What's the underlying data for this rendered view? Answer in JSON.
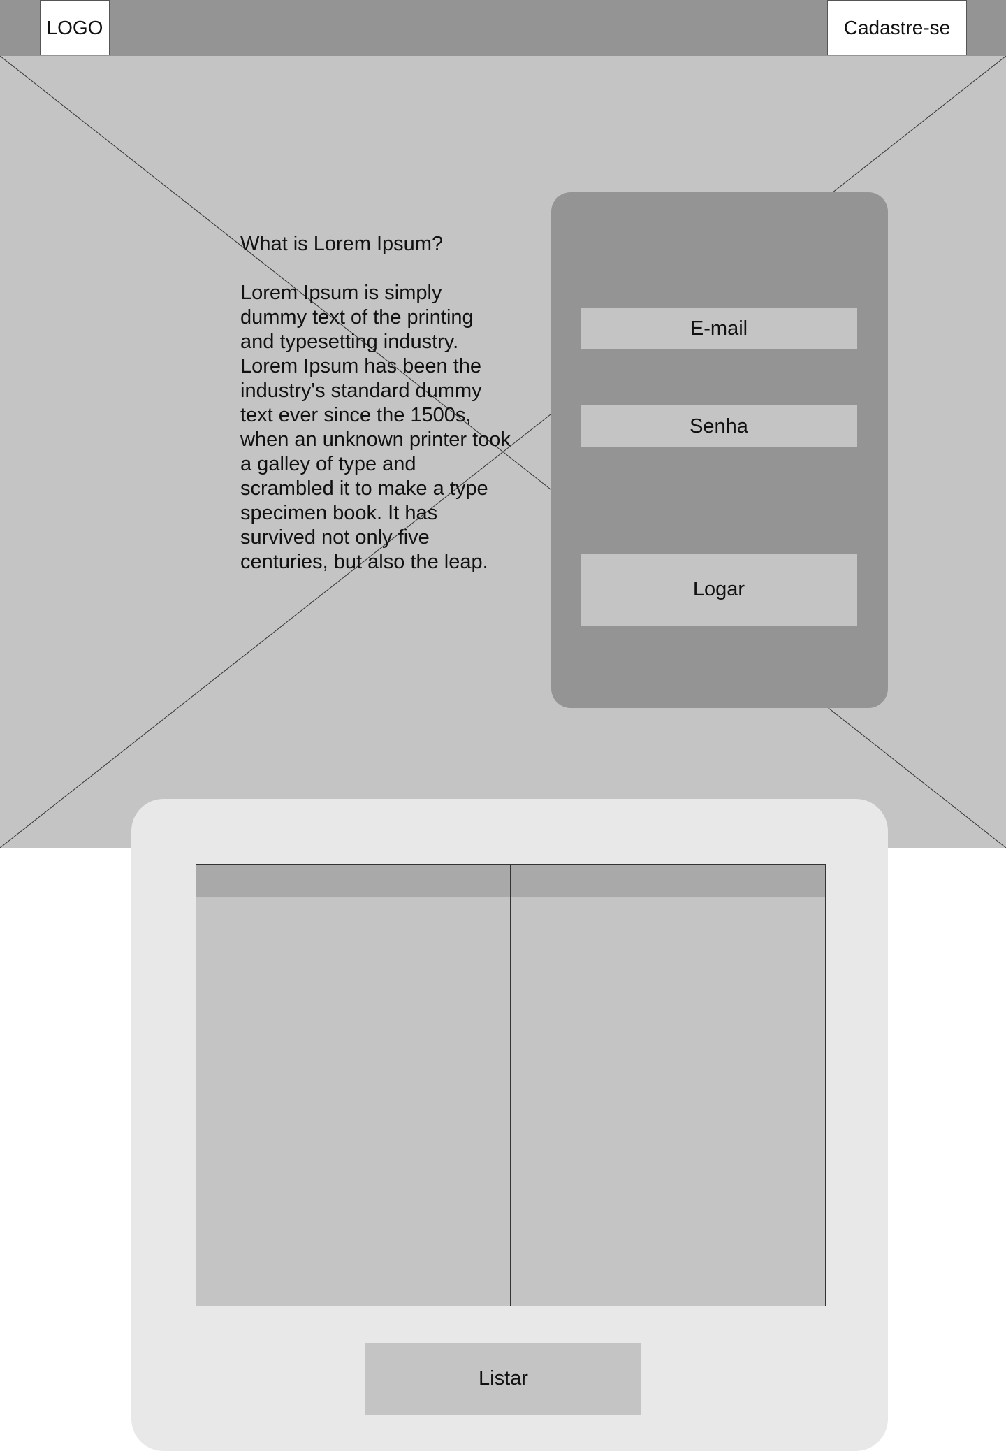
{
  "header": {
    "logo_text": "LOGO",
    "signup_label": "Cadastre-se"
  },
  "hero": {
    "title": "What is Lorem Ipsum?",
    "body": "Lorem Ipsum is simply dummy text of the printing and typesetting industry. Lorem Ipsum has been the industry's standard dummy text ever since the 1500s, when an unknown printer took a galley of type and scrambled it to make a type specimen book. It has survived not only five centuries, but also the leap."
  },
  "login": {
    "email_label": "E-mail",
    "password_label": "Senha",
    "submit_label": "Logar"
  },
  "list": {
    "columns": [
      "",
      "",
      "",
      ""
    ],
    "button_label": "Listar"
  },
  "colors": {
    "header_bg": "#949494",
    "hero_bg": "#c4c4c4",
    "card_bg": "#949494",
    "list_bg": "#e8e8e8",
    "table_header_bg": "#a9a9a9"
  }
}
